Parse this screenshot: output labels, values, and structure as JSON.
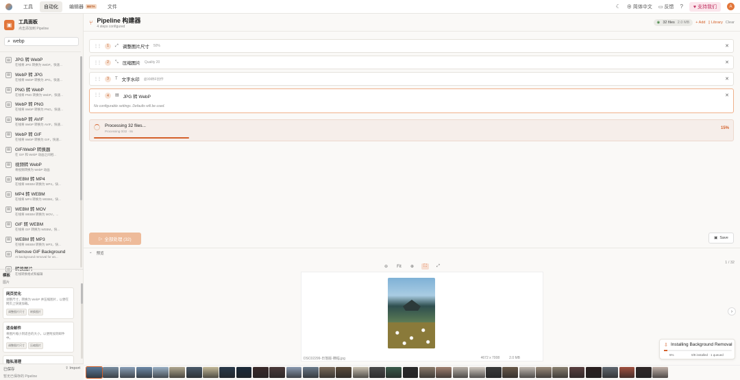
{
  "topbar": {
    "nav": [
      {
        "label": "工具",
        "active": false
      },
      {
        "label": "自动化",
        "active": true
      },
      {
        "label": "编辑器",
        "active": false,
        "badge": "BETA"
      },
      {
        "label": "文件",
        "active": false
      }
    ],
    "language": "简体中文",
    "feedback": "反馈",
    "support": "支持我们",
    "avatar_letter": "A"
  },
  "sidebar": {
    "title": "工具面板",
    "subtitle": "点击添加到 Pipeline",
    "search_value": "webp",
    "tools": [
      {
        "name": "JPG 转 WebP",
        "desc": "在线将 JPG 转换为 WebP，快速..."
      },
      {
        "name": "WebP 转 JPG",
        "desc": "在线将 WebP 转换为 JPG，快速..."
      },
      {
        "name": "PNG 转 WebP",
        "desc": "在线将 PNG 转换为 WebP，快速..."
      },
      {
        "name": "WebP 转 PNG",
        "desc": "在线将 WebP 转换为 PNG，快速..."
      },
      {
        "name": "WebP 转 AVIF",
        "desc": "在线将 WebP 转换为 AVIF，快速..."
      },
      {
        "name": "WebP 转 GIF",
        "desc": "在线将 WebP 转换为 GIF，快速..."
      },
      {
        "name": "GIF/WebP 转换器",
        "desc": "在 GIF 和 WebP 动画之间相..."
      },
      {
        "name": "视频转 WebP",
        "desc": "将视频转换为 WebP 动画"
      },
      {
        "name": "WEBM 转 MP4",
        "desc": "在线将 WEBM 转换为 MP4，快..."
      },
      {
        "name": "MP4 转 WEBM",
        "desc": "在线将 MP4 转换为 WEBM，快..."
      },
      {
        "name": "WEBM 转 MOV",
        "desc": "在线将 WEBM 转换为 MOV，..."
      },
      {
        "name": "GIF 转 WEBM",
        "desc": "在线将 GIF 转换为 WEBM，快..."
      },
      {
        "name": "WEBM 转 MP3",
        "desc": "在线将 WEBM 转换为 MP3，快..."
      },
      {
        "name": "Remove GIF Background",
        "desc": "AI background removal for an..."
      },
      {
        "name": "转换图片",
        "desc": "在线转换格式和编辑"
      }
    ],
    "templates_label": "模板",
    "templates_sub": "图片",
    "templates": [
      {
        "name": "网页优化",
        "desc": "调整尺寸，转换为 WebP 并压缩图片，以便在网页上快速加载。",
        "tags": [
          "调整图片尺寸",
          "转换图片"
        ]
      },
      {
        "name": "适合邮件",
        "desc": "将图片缩小到适合的大小，以便附加到邮件中。",
        "tags": [
          "调整图片尺寸",
          "压缩图片"
        ]
      },
      {
        "name": "隐私清理",
        "desc": "去除 EXIF、GPS 和其他元数据，我们压缩...",
        "tags": []
      }
    ],
    "saved_label": "已保存",
    "saved_sub": "暂无已保存的 Pipeline",
    "import_label": "Import"
  },
  "pipeline": {
    "title": "Pipeline 构建器",
    "subtitle": "4 steps configured",
    "files_pill": "32 files",
    "size_pill": "2.0 MB",
    "add_label": "+ Add",
    "library_label": "Library",
    "clear_label": "Clear",
    "steps": [
      {
        "num": "1",
        "icon": "⤢",
        "name": "调整图片尺寸",
        "detail": "50%"
      },
      {
        "num": "2",
        "icon": "⤡",
        "name": "压缩图片",
        "detail": "Quality 20"
      },
      {
        "num": "3",
        "icon": "T",
        "name": "文字水印",
        "detail": "@XMBF创作"
      },
      {
        "num": "4",
        "icon": "▤",
        "name": "JPG 转 WebP",
        "detail": ""
      }
    ],
    "no_settings": "No configurable settings. Defaults will be used.",
    "progress": {
      "title": "Processing 32 files...",
      "sub": "Processing 0/32 · 8s",
      "pct_label": "15%",
      "fraction": 0.15
    },
    "run_label": "全部处理 (32)",
    "save_label": "Save"
  },
  "preview": {
    "label": "预览",
    "counter": "1 / 32",
    "fit_label": "Fit",
    "file_name": "DSC02299-日落版·横幅.jpg",
    "dimensions": "4672 x 7008",
    "size": "2.0 MB"
  },
  "install": {
    "title": "Installing Background Removal",
    "pct_label": "5%",
    "stats": "0/8 installed · 1 queued",
    "fraction": 0.05
  },
  "thumb_colors": [
    "#5a7a9a",
    "#7a8fa3",
    "#8aa0b8",
    "#6d8aa8",
    "#9ab0c5",
    "#b0a890",
    "#4a5a6a",
    "#c2b898",
    "#2a3a4a",
    "#1a2a3a",
    "#3a2a2a",
    "#4a3a3a",
    "#8a9ab0",
    "#6a7a8a",
    "#7a6a5a",
    "#5a4a3a",
    "#c8c0b0",
    "#4a4a4a",
    "#3a5a4a",
    "#2a2a2a",
    "#8a7a6a",
    "#a08070",
    "#b8b0a8",
    "#d0c8c0",
    "#3a3a3a",
    "#6a5a4a",
    "#c0b8b0",
    "#9a8a7a",
    "#8a8070",
    "#5a4040",
    "#2a2020",
    "#606870",
    "#a05040",
    "#302828",
    "#c0b0a8"
  ]
}
